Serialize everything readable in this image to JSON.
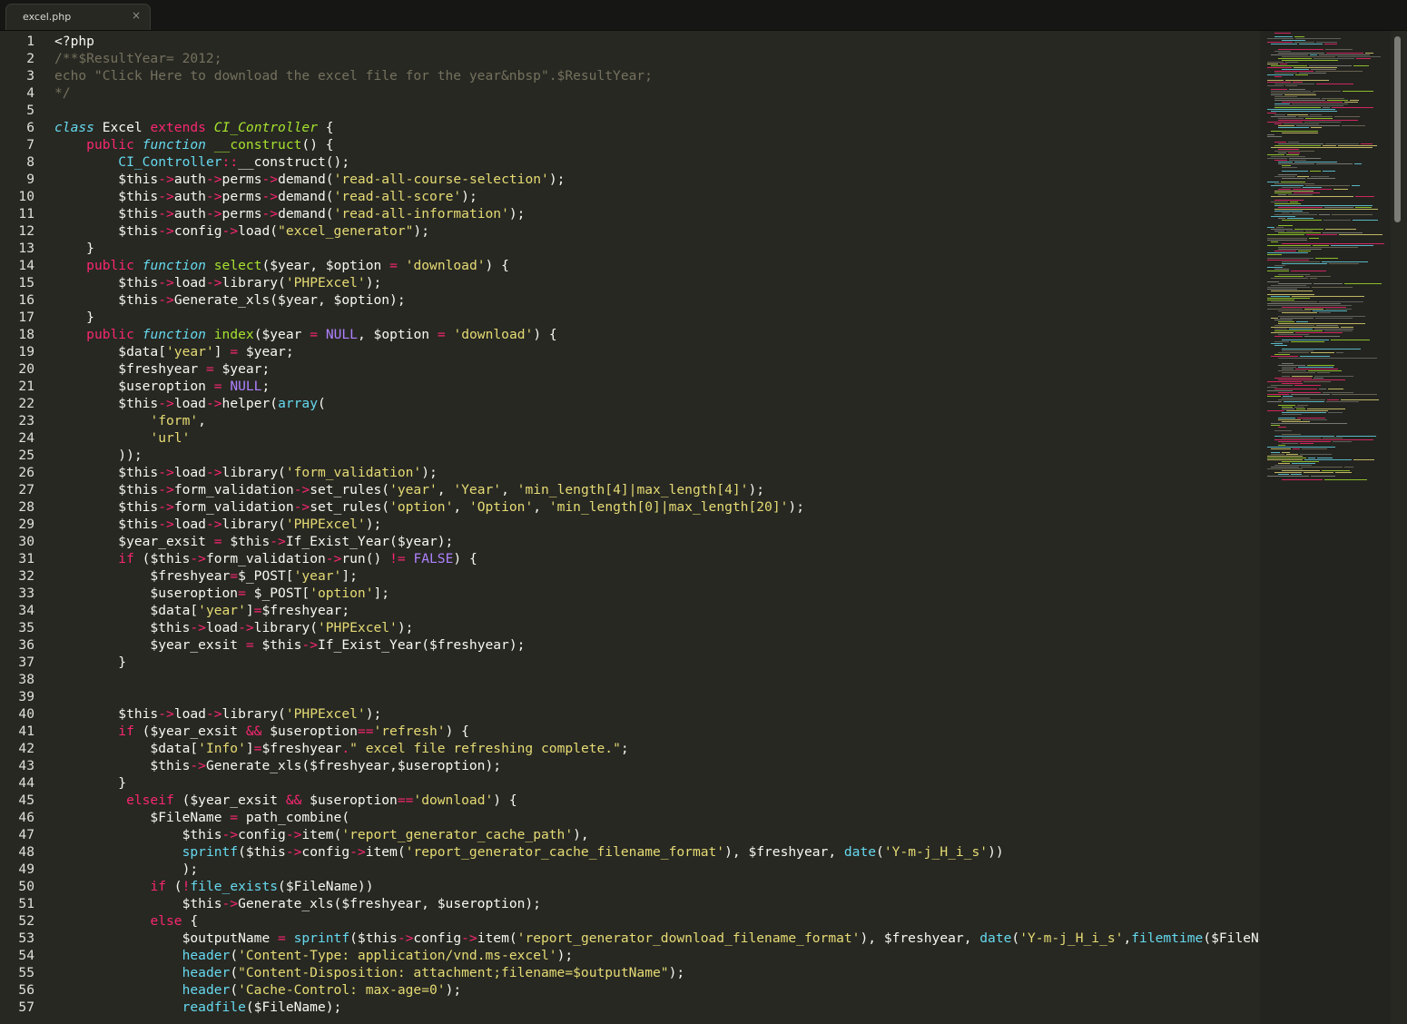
{
  "tab": {
    "title": "excel.php",
    "close": "×"
  },
  "colors": {
    "background": "#272822",
    "keyword": "#f92672",
    "storage": "#66d9ef",
    "class": "#a6e22e",
    "function": "#a6e22e",
    "builtin": "#66d9ef",
    "string": "#e6db74",
    "constant": "#ae81ff",
    "comment": "#75715e",
    "text": "#f8f8f2"
  },
  "icons": {
    "close": "close-icon"
  },
  "lines": [
    [
      [
        "t",
        "<?php"
      ]
    ],
    [
      [
        "c",
        "/**$ResultYear= 2012;"
      ]
    ],
    [
      [
        "c",
        "echo \"Click Here to download the excel file for the year&nbsp\".$ResultYear;"
      ]
    ],
    [
      [
        "c",
        "*/"
      ]
    ],
    [],
    [
      [
        "s",
        "class"
      ],
      [
        "t",
        " Excel "
      ],
      [
        "k",
        "extends"
      ],
      [
        "t",
        " "
      ],
      [
        "C",
        "CI_Controller"
      ],
      [
        "t",
        " {"
      ]
    ],
    [
      [
        "t",
        "    "
      ],
      [
        "k",
        "public"
      ],
      [
        "t",
        " "
      ],
      [
        "s",
        "function"
      ],
      [
        "t",
        " "
      ],
      [
        "f",
        "__construct"
      ],
      [
        "t",
        "() {"
      ]
    ],
    [
      [
        "t",
        "        "
      ],
      [
        "b",
        "CI_Controller"
      ],
      [
        "o",
        "::"
      ],
      [
        "t",
        "__construct();"
      ]
    ],
    [
      [
        "t",
        "        $this"
      ],
      [
        "o",
        "->"
      ],
      [
        "t",
        "auth"
      ],
      [
        "o",
        "->"
      ],
      [
        "t",
        "perms"
      ],
      [
        "o",
        "->"
      ],
      [
        "t",
        "demand("
      ],
      [
        "r",
        "'read-all-course-selection'"
      ],
      [
        "t",
        ");"
      ]
    ],
    [
      [
        "t",
        "        $this"
      ],
      [
        "o",
        "->"
      ],
      [
        "t",
        "auth"
      ],
      [
        "o",
        "->"
      ],
      [
        "t",
        "perms"
      ],
      [
        "o",
        "->"
      ],
      [
        "t",
        "demand("
      ],
      [
        "r",
        "'read-all-score'"
      ],
      [
        "t",
        ");"
      ]
    ],
    [
      [
        "t",
        "        $this"
      ],
      [
        "o",
        "->"
      ],
      [
        "t",
        "auth"
      ],
      [
        "o",
        "->"
      ],
      [
        "t",
        "perms"
      ],
      [
        "o",
        "->"
      ],
      [
        "t",
        "demand("
      ],
      [
        "r",
        "'read-all-information'"
      ],
      [
        "t",
        ");"
      ]
    ],
    [
      [
        "t",
        "        $this"
      ],
      [
        "o",
        "->"
      ],
      [
        "t",
        "config"
      ],
      [
        "o",
        "->"
      ],
      [
        "t",
        "load("
      ],
      [
        "r",
        "\"excel_generator\""
      ],
      [
        "t",
        ");"
      ]
    ],
    [
      [
        "t",
        "    }"
      ]
    ],
    [
      [
        "t",
        "    "
      ],
      [
        "k",
        "public"
      ],
      [
        "t",
        " "
      ],
      [
        "s",
        "function"
      ],
      [
        "t",
        " "
      ],
      [
        "f",
        "select"
      ],
      [
        "t",
        "($year, $option "
      ],
      [
        "o",
        "="
      ],
      [
        "t",
        " "
      ],
      [
        "r",
        "'download'"
      ],
      [
        "t",
        ") {"
      ]
    ],
    [
      [
        "t",
        "        $this"
      ],
      [
        "o",
        "->"
      ],
      [
        "t",
        "load"
      ],
      [
        "o",
        "->"
      ],
      [
        "t",
        "library("
      ],
      [
        "r",
        "'PHPExcel'"
      ],
      [
        "t",
        ");"
      ]
    ],
    [
      [
        "t",
        "        $this"
      ],
      [
        "o",
        "->"
      ],
      [
        "t",
        "Generate_xls($year, $option);"
      ]
    ],
    [
      [
        "t",
        "    }"
      ]
    ],
    [
      [
        "t",
        "    "
      ],
      [
        "k",
        "public"
      ],
      [
        "t",
        " "
      ],
      [
        "s",
        "function"
      ],
      [
        "t",
        " "
      ],
      [
        "f",
        "index"
      ],
      [
        "t",
        "($year "
      ],
      [
        "o",
        "="
      ],
      [
        "t",
        " "
      ],
      [
        "n",
        "NULL"
      ],
      [
        "t",
        ", $option "
      ],
      [
        "o",
        "="
      ],
      [
        "t",
        " "
      ],
      [
        "r",
        "'download'"
      ],
      [
        "t",
        ") {"
      ]
    ],
    [
      [
        "t",
        "        $data["
      ],
      [
        "r",
        "'year'"
      ],
      [
        "t",
        "] "
      ],
      [
        "o",
        "="
      ],
      [
        "t",
        " $year;"
      ]
    ],
    [
      [
        "t",
        "        $freshyear "
      ],
      [
        "o",
        "="
      ],
      [
        "t",
        " $year;"
      ]
    ],
    [
      [
        "t",
        "        $useroption "
      ],
      [
        "o",
        "="
      ],
      [
        "t",
        " "
      ],
      [
        "n",
        "NULL"
      ],
      [
        "t",
        ";"
      ]
    ],
    [
      [
        "t",
        "        $this"
      ],
      [
        "o",
        "->"
      ],
      [
        "t",
        "load"
      ],
      [
        "o",
        "->"
      ],
      [
        "t",
        "helper("
      ],
      [
        "b",
        "array"
      ],
      [
        "t",
        "("
      ]
    ],
    [
      [
        "t",
        "            "
      ],
      [
        "r",
        "'form'"
      ],
      [
        "t",
        ","
      ]
    ],
    [
      [
        "t",
        "            "
      ],
      [
        "r",
        "'url'"
      ]
    ],
    [
      [
        "t",
        "        ));"
      ]
    ],
    [
      [
        "t",
        "        $this"
      ],
      [
        "o",
        "->"
      ],
      [
        "t",
        "load"
      ],
      [
        "o",
        "->"
      ],
      [
        "t",
        "library("
      ],
      [
        "r",
        "'form_validation'"
      ],
      [
        "t",
        ");"
      ]
    ],
    [
      [
        "t",
        "        $this"
      ],
      [
        "o",
        "->"
      ],
      [
        "t",
        "form_validation"
      ],
      [
        "o",
        "->"
      ],
      [
        "t",
        "set_rules("
      ],
      [
        "r",
        "'year'"
      ],
      [
        "t",
        ", "
      ],
      [
        "r",
        "'Year'"
      ],
      [
        "t",
        ", "
      ],
      [
        "r",
        "'min_length[4]|max_length[4]'"
      ],
      [
        "t",
        ");"
      ]
    ],
    [
      [
        "t",
        "        $this"
      ],
      [
        "o",
        "->"
      ],
      [
        "t",
        "form_validation"
      ],
      [
        "o",
        "->"
      ],
      [
        "t",
        "set_rules("
      ],
      [
        "r",
        "'option'"
      ],
      [
        "t",
        ", "
      ],
      [
        "r",
        "'Option'"
      ],
      [
        "t",
        ", "
      ],
      [
        "r",
        "'min_length[0]|max_length[20]'"
      ],
      [
        "t",
        ");"
      ]
    ],
    [
      [
        "t",
        "        $this"
      ],
      [
        "o",
        "->"
      ],
      [
        "t",
        "load"
      ],
      [
        "o",
        "->"
      ],
      [
        "t",
        "library("
      ],
      [
        "r",
        "'PHPExcel'"
      ],
      [
        "t",
        ");"
      ]
    ],
    [
      [
        "t",
        "        $year_exsit "
      ],
      [
        "o",
        "="
      ],
      [
        "t",
        " $this"
      ],
      [
        "o",
        "->"
      ],
      [
        "t",
        "If_Exist_Year($year);"
      ]
    ],
    [
      [
        "t",
        "        "
      ],
      [
        "k",
        "if"
      ],
      [
        "t",
        " ($this"
      ],
      [
        "o",
        "->"
      ],
      [
        "t",
        "form_validation"
      ],
      [
        "o",
        "->"
      ],
      [
        "t",
        "run() "
      ],
      [
        "o",
        "!="
      ],
      [
        "t",
        " "
      ],
      [
        "n",
        "FALSE"
      ],
      [
        "t",
        ") {"
      ]
    ],
    [
      [
        "t",
        "            $freshyear"
      ],
      [
        "o",
        "="
      ],
      [
        "t",
        "$_POST["
      ],
      [
        "r",
        "'year'"
      ],
      [
        "t",
        "];"
      ]
    ],
    [
      [
        "t",
        "            $useroption"
      ],
      [
        "o",
        "="
      ],
      [
        "t",
        " $_POST["
      ],
      [
        "r",
        "'option'"
      ],
      [
        "t",
        "];"
      ]
    ],
    [
      [
        "t",
        "            $data["
      ],
      [
        "r",
        "'year'"
      ],
      [
        "t",
        "]"
      ],
      [
        "o",
        "="
      ],
      [
        "t",
        "$freshyear;"
      ]
    ],
    [
      [
        "t",
        "            $this"
      ],
      [
        "o",
        "->"
      ],
      [
        "t",
        "load"
      ],
      [
        "o",
        "->"
      ],
      [
        "t",
        "library("
      ],
      [
        "r",
        "'PHPExcel'"
      ],
      [
        "t",
        ");"
      ]
    ],
    [
      [
        "t",
        "            $year_exsit "
      ],
      [
        "o",
        "="
      ],
      [
        "t",
        " $this"
      ],
      [
        "o",
        "->"
      ],
      [
        "t",
        "If_Exist_Year($freshyear);"
      ]
    ],
    [
      [
        "t",
        "        }"
      ]
    ],
    [],
    [],
    [
      [
        "t",
        "        $this"
      ],
      [
        "o",
        "->"
      ],
      [
        "t",
        "load"
      ],
      [
        "o",
        "->"
      ],
      [
        "t",
        "library("
      ],
      [
        "r",
        "'PHPExcel'"
      ],
      [
        "t",
        ");"
      ]
    ],
    [
      [
        "t",
        "        "
      ],
      [
        "k",
        "if"
      ],
      [
        "t",
        " ($year_exsit "
      ],
      [
        "o",
        "&&"
      ],
      [
        "t",
        " $useroption"
      ],
      [
        "o",
        "=="
      ],
      [
        "r",
        "'refresh'"
      ],
      [
        "t",
        ") {"
      ]
    ],
    [
      [
        "t",
        "            $data["
      ],
      [
        "r",
        "'Info'"
      ],
      [
        "t",
        "]"
      ],
      [
        "o",
        "="
      ],
      [
        "t",
        "$freshyear"
      ],
      [
        "o",
        "."
      ],
      [
        "r",
        "\" excel file refreshing complete.\""
      ],
      [
        "t",
        ";"
      ]
    ],
    [
      [
        "t",
        "            $this"
      ],
      [
        "o",
        "->"
      ],
      [
        "t",
        "Generate_xls($freshyear,$useroption);"
      ]
    ],
    [
      [
        "t",
        "        }"
      ]
    ],
    [
      [
        "t",
        "         "
      ],
      [
        "k",
        "elseif"
      ],
      [
        "t",
        " ($year_exsit "
      ],
      [
        "o",
        "&&"
      ],
      [
        "t",
        " $useroption"
      ],
      [
        "o",
        "=="
      ],
      [
        "r",
        "'download'"
      ],
      [
        "t",
        ") {"
      ]
    ],
    [
      [
        "t",
        "            $FileName "
      ],
      [
        "o",
        "="
      ],
      [
        "t",
        " path_combine("
      ]
    ],
    [
      [
        "t",
        "                $this"
      ],
      [
        "o",
        "->"
      ],
      [
        "t",
        "config"
      ],
      [
        "o",
        "->"
      ],
      [
        "t",
        "item("
      ],
      [
        "r",
        "'report_generator_cache_path'"
      ],
      [
        "t",
        "),"
      ]
    ],
    [
      [
        "t",
        "                "
      ],
      [
        "b",
        "sprintf"
      ],
      [
        "t",
        "($this"
      ],
      [
        "o",
        "->"
      ],
      [
        "t",
        "config"
      ],
      [
        "o",
        "->"
      ],
      [
        "t",
        "item("
      ],
      [
        "r",
        "'report_generator_cache_filename_format'"
      ],
      [
        "t",
        "), $freshyear, "
      ],
      [
        "b",
        "date"
      ],
      [
        "t",
        "("
      ],
      [
        "r",
        "'Y-m-j_H_i_s'"
      ],
      [
        "t",
        "))"
      ]
    ],
    [
      [
        "t",
        "                );"
      ]
    ],
    [
      [
        "t",
        "            "
      ],
      [
        "k",
        "if"
      ],
      [
        "t",
        " ("
      ],
      [
        "o",
        "!"
      ],
      [
        "b",
        "file_exists"
      ],
      [
        "t",
        "($FileName))"
      ]
    ],
    [
      [
        "t",
        "                $this"
      ],
      [
        "o",
        "->"
      ],
      [
        "t",
        "Generate_xls($freshyear, $useroption);"
      ]
    ],
    [
      [
        "t",
        "            "
      ],
      [
        "k",
        "else"
      ],
      [
        "t",
        " {"
      ]
    ],
    [
      [
        "t",
        "                $outputName "
      ],
      [
        "o",
        "="
      ],
      [
        "t",
        " "
      ],
      [
        "b",
        "sprintf"
      ],
      [
        "t",
        "($this"
      ],
      [
        "o",
        "->"
      ],
      [
        "t",
        "config"
      ],
      [
        "o",
        "->"
      ],
      [
        "t",
        "item("
      ],
      [
        "r",
        "'report_generator_download_filename_format'"
      ],
      [
        "t",
        "), $freshyear, "
      ],
      [
        "b",
        "date"
      ],
      [
        "t",
        "("
      ],
      [
        "r",
        "'Y-m-j_H_i_s'"
      ],
      [
        "t",
        ","
      ],
      [
        "b",
        "filemtime"
      ],
      [
        "t",
        "($FileName"
      ]
    ],
    [
      [
        "t",
        "                "
      ],
      [
        "b",
        "header"
      ],
      [
        "t",
        "("
      ],
      [
        "r",
        "'Content-Type: application/vnd.ms-excel'"
      ],
      [
        "t",
        ");"
      ]
    ],
    [
      [
        "t",
        "                "
      ],
      [
        "b",
        "header"
      ],
      [
        "t",
        "("
      ],
      [
        "r",
        "\"Content-Disposition: attachment;filename=$outputName\""
      ],
      [
        "t",
        ");"
      ]
    ],
    [
      [
        "t",
        "                "
      ],
      [
        "b",
        "header"
      ],
      [
        "t",
        "("
      ],
      [
        "r",
        "'Cache-Control: max-age=0'"
      ],
      [
        "t",
        ");"
      ]
    ],
    [
      [
        "t",
        "                "
      ],
      [
        "b",
        "readfile"
      ],
      [
        "t",
        "($FileName);"
      ]
    ]
  ]
}
